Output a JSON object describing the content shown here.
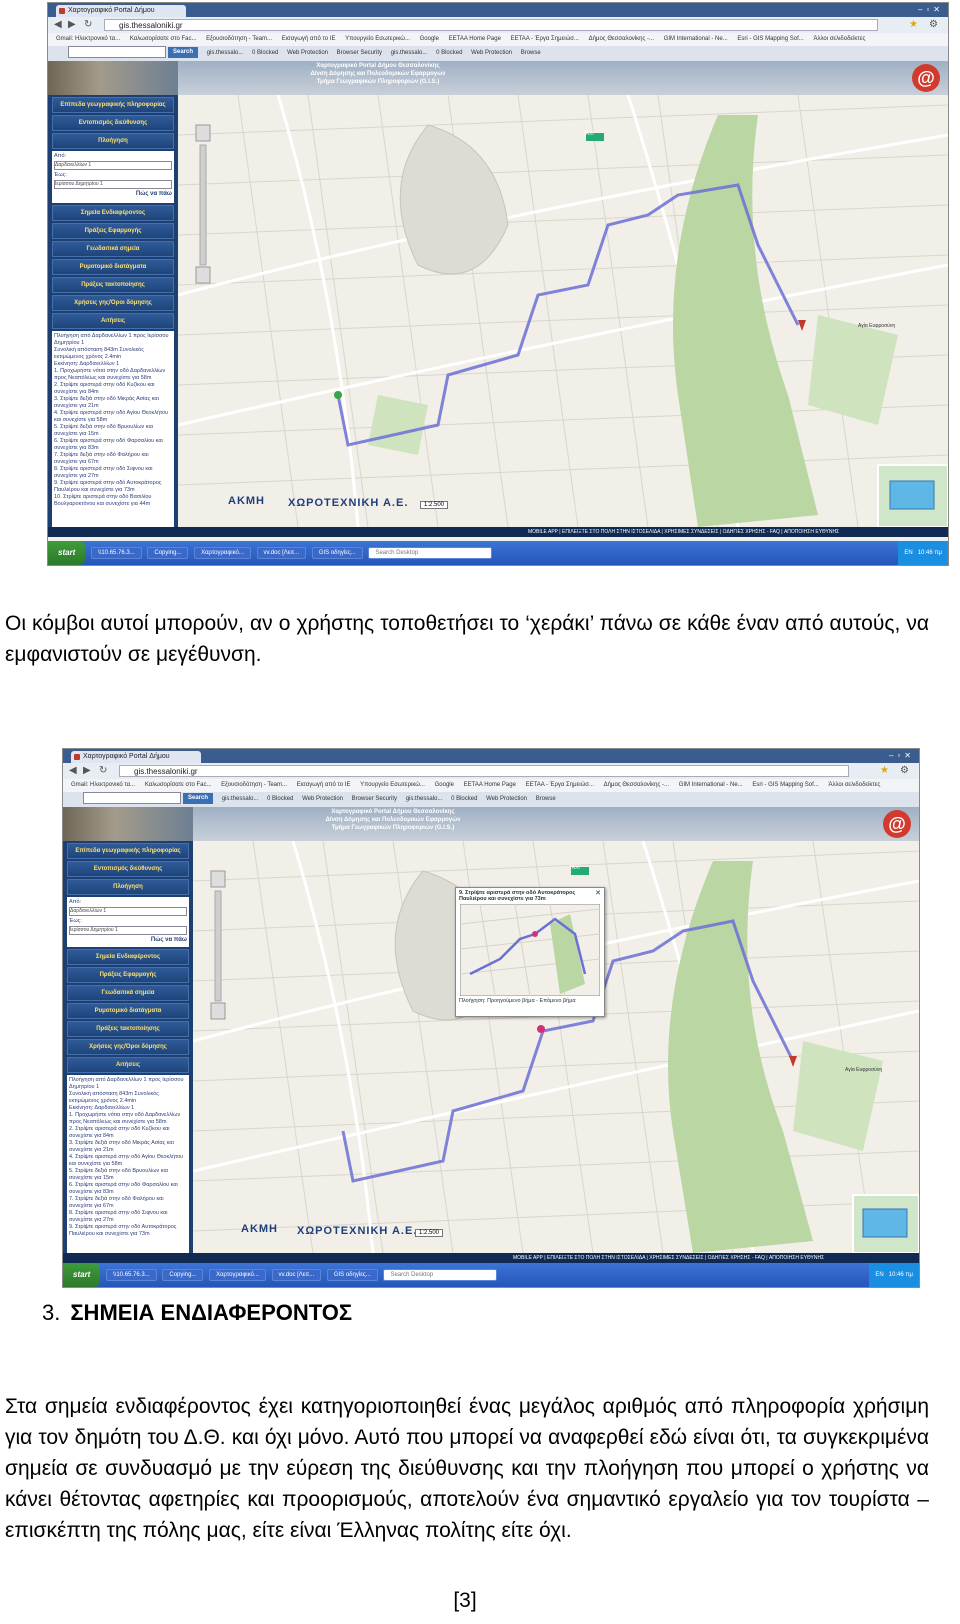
{
  "browser": {
    "tab_title": "Χαρτογραφικό Portal Δήμου",
    "url": "gis.thessaloniki.gr",
    "bookmarks": [
      "Gmail: Ηλεκτρονικό τα...",
      "Καλωσορίσατε στο Fac...",
      "Εξουσιοδότηση - Team...",
      "Εισαγωγή από το IE",
      "Υπουργείο Εσωτερικώ...",
      "Google",
      "EETAA Home Page",
      "EETAA - Έργα Σημειώσ...",
      "Δήμος Θεσσαλονίκης -...",
      "GIM International - Ne...",
      "Esri - GIS Mapping Sof...",
      "Άλλοι σελιδοδείκτες"
    ],
    "toolbar_items": [
      "gis.thessalo...",
      "0 Blocked",
      "Web Protection",
      "Browser Security",
      "gis.thessalo...",
      "0 Blocked",
      "Web Protection",
      "Browse"
    ],
    "search_button": "Search"
  },
  "portal": {
    "header_lines": [
      "Χαρτογραφικό Portal Δήμου Θεσσαλονίκης",
      "Δ/νση Δόμησης και Πολεοδομικών Εφαρμογών",
      "Τμήμα Γεωγραφικών Πληροφοριών (G.I.S.)"
    ],
    "menu_top": [
      "Επίπεδα γεωγραφικής πληροφορίας",
      "Εντοπισμός διεύθυνσης",
      "Πλοήγηση"
    ],
    "route_from_label": "Από:",
    "route_from_value": "Δαρδανελλίων 1",
    "route_to_label": "Έως:",
    "route_to_value": "Ιερίσσου Δημητρίου 1",
    "route_go": "Πώς να πάω",
    "menu_bottom": [
      "Σημεία Ενδιαφέροντος",
      "Πράξεις Εφαρμογής",
      "Γεωδαιτικά σημεία",
      "Ρυμοτομικό διατάγματα",
      "Πράξεις τακτοποίησης",
      "Χρήσεις γης/Όροι δόμησης",
      "Αιτήσεις"
    ],
    "directions_title": "Πλοήγηση από Δαρδανελλίων 1 προς Ιερίσσου Δημητρίου 1",
    "directions_summary": "Συνολική απόσταση 843m Συνολικός εκτιμώμενος χρόνος 2.4min",
    "directions_start": "Εκκίνηση: Δαρδανελλίων 1",
    "directions_steps": [
      "1. Προχωρήστε νότια στην οδό Δαρδανελλίων προς Νεαπόλεως και συνεχίστε για 58m",
      "2. Στρίψτε αριστερά στην οδό Κυζίκου και συνεχίστε για 84m",
      "3. Στρίψτε δεξιά στην οδό Μικράς Ασίας και συνεχίστε για 21m",
      "4. Στρίψτε αριστερά στην οδό Αγίου Θεοκλήτου και συνεχίστε για 58m",
      "5. Στρίψτε δεξιά στην οδό Βρυουλίων και συνεχίστε για 15m",
      "6. Στρίψτε αριστερά στην οδό Φαρσαλίου και συνεχίστε για 83m",
      "7. Στρίψτε δεξιά στην οδό Φαλήρου και συνεχίστε για 67m",
      "8. Στρίψτε αριστερά στην οδό Σιφνου και συνεχίστε για 27m",
      "9. Στρίψτε αριστερά στην οδό Αυτοκράτορος Παυλιέρου και συνεχίστε για 73m",
      "10. Στρίψτε αριστερά στην οδό Βασιλίου Βουλγαροκτόνου και συνεχίστε για 44m"
    ],
    "brand_text": "ΧΩΡΟΤΕΧΝΙΚΗ Α.Ε.",
    "brand_left": "ΑΚΜΗ",
    "scale_text": "1:2.500",
    "poi_label": "Αγία Ευφροσύνη",
    "taxi_label": "TAXI",
    "status_bar": "MOBILE APP | ΕΠΙΛΕΙΞΤΕ ΣΤΟ ΠΟΛΗ ΣΤΗΝ ΙΣΤΟΣΕΛΙΔΑ | ΧΡΗΣΙΜΕΣ ΣΥΝΔΕΣΕΙΣ | ΟΔΗΓΙΕΣ ΧΡΗΣΗΣ - FAQ | ΑΠΟΠΟΙΗΣΗ ΕΥΘΥΝΗΣ",
    "popup_title": "9. Στρίψτε αριστερά στην οδό Αυτοκράτορος Παυλιέρου και συνεχίστε για 73m",
    "popup_nav": "Πλοήγηση: Προηγούμενο βήμα - Επόμενο βήμα"
  },
  "taskbar": {
    "start": "start",
    "tasks": [
      "\\\\10.65.76.3...",
      "Copying...",
      "Χαρτογραφικό...",
      "vv.doc [Λειτ...",
      "GIS οδηγίες..."
    ],
    "search": "Search Desktop",
    "lang": "EN",
    "clock": "10:46 πμ"
  },
  "doc": {
    "para1": "Οι κόμβοι αυτοί μπορούν, αν ο χρήστης τοποθετήσει το ‘χεράκι’ πάνω σε κάθε έναν από αυτούς, να εμφανιστούν σε μεγέθυνση.",
    "section_number": "3.",
    "section_title": "ΣΗΜΕΙΑ ΕΝΔΙΑΦΕΡΟΝΤΟΣ",
    "para2": "Στα σημεία ενδιαφέροντος έχει κατηγοριοποιηθεί ένας μεγάλος αριθμός από πληροφορία χρήσιμη για τον δημότη του Δ.Θ. και όχι μόνο. Αυτό που μπορεί να αναφερθεί εδώ είναι ότι, τα συγκεκριμένα σημεία σε συνδυασμό με την εύρεση της διεύθυνσης και την πλοήγηση που μπορεί ο χρήστης να κάνει θέτοντας αφετηρίες και προορισμούς, αποτελούν ένα σημαντικό εργαλείο για τον τουρίστα – επισκέπτη της πόλης μας, είτε είναι Έλληνας πολίτης είτε όχι.",
    "page_number": "[3]"
  }
}
